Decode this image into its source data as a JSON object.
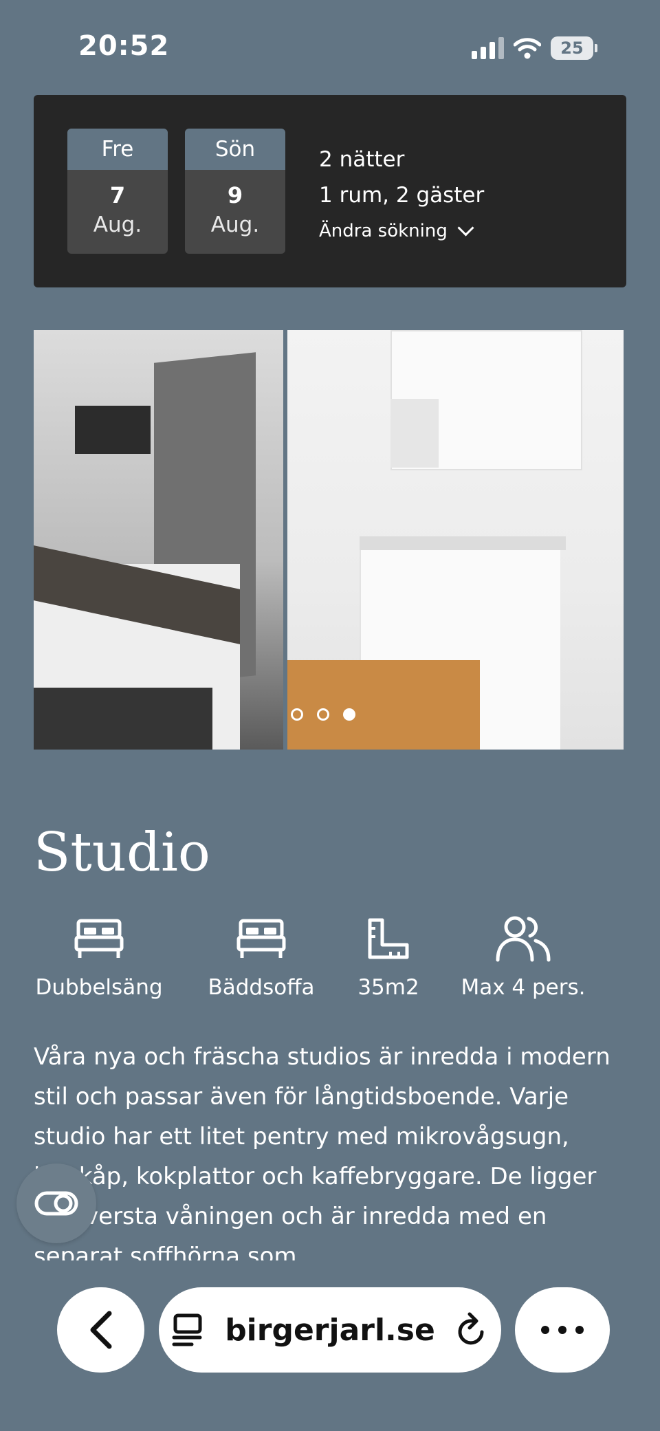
{
  "status_bar": {
    "time": "20:52",
    "battery": "25"
  },
  "booking": {
    "checkin": {
      "day": "Fre",
      "date": "7",
      "month": "Aug."
    },
    "checkout": {
      "day": "Sön",
      "date": "9",
      "month": "Aug."
    },
    "nights": "2 nätter",
    "rooms_guests": "1 rum, 2 gäster",
    "change_search": "Ändra sökning"
  },
  "gallery": {
    "total_images": 3,
    "active_index": 2
  },
  "room": {
    "title": "Studio",
    "amenities": [
      {
        "icon": "bed-icon",
        "label": "Dubbelsäng"
      },
      {
        "icon": "bed-icon",
        "label": "Bäddsoffa"
      },
      {
        "icon": "ruler-icon",
        "label": "35m2"
      },
      {
        "icon": "users-icon",
        "label": "Max 4 pers."
      }
    ],
    "description": "Våra nya och fräscha studios är inredda i modern stil och passar även för långtidsboende. Varje studio har ett litet pentry med mikrovågsugn, kylskåp, kokplattor och kaffebryggare. De ligger på översta våningen och är inredda med en separat soffhörna som"
  },
  "browser": {
    "url": "birgerjarl.se"
  },
  "colors": {
    "background": "#627584",
    "card": "#262626",
    "date_box": "#474747"
  }
}
